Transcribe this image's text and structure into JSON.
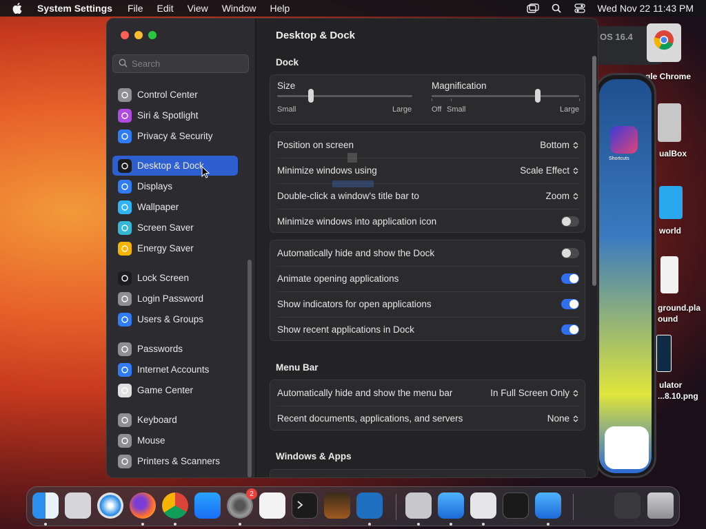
{
  "menubar": {
    "app_name": "System Settings",
    "items": [
      "File",
      "Edit",
      "View",
      "Window",
      "Help"
    ],
    "datetime": "Wed Nov 22  11:43 PM"
  },
  "desktop": {
    "behind_window_text": "OS 16.4",
    "chrome_label": "Google Chrome",
    "vbox_label": "ualBox",
    "folder_label": "world",
    "playground_label_1": "ground.pla",
    "playground_label_2": "ound",
    "png_label_1": "ulator",
    "png_label_2": "...8.10.png",
    "phone_app_label": "Shortcuts"
  },
  "sidebar": {
    "search_placeholder": "Search",
    "items": [
      {
        "label": "Control Center",
        "icon": "control-center-icon",
        "color": "#8e8e93"
      },
      {
        "label": "Siri & Spotlight",
        "icon": "siri-icon",
        "color": "#b04be0"
      },
      {
        "label": "Privacy & Security",
        "icon": "hand-icon",
        "color": "#2f7cf6"
      },
      {
        "label": "Desktop & Dock",
        "icon": "dock-icon",
        "color": "#1c1c1e"
      },
      {
        "label": "Displays",
        "icon": "sun-icon",
        "color": "#2f7cf6"
      },
      {
        "label": "Wallpaper",
        "icon": "flower-icon",
        "color": "#2fb4f6"
      },
      {
        "label": "Screen Saver",
        "icon": "screensaver-icon",
        "color": "#35b8d6"
      },
      {
        "label": "Energy Saver",
        "icon": "bulb-icon",
        "color": "#f5b400"
      },
      {
        "label": "Lock Screen",
        "icon": "lock-icon",
        "color": "#1c1c1e"
      },
      {
        "label": "Login Password",
        "icon": "lock-icon",
        "color": "#8e8e93"
      },
      {
        "label": "Users & Groups",
        "icon": "users-icon",
        "color": "#2f7cf6"
      },
      {
        "label": "Passwords",
        "icon": "key-icon",
        "color": "#8e8e93"
      },
      {
        "label": "Internet Accounts",
        "icon": "at-icon",
        "color": "#2f7cf6"
      },
      {
        "label": "Game Center",
        "icon": "game-center-icon",
        "color": "#e0e0e0"
      },
      {
        "label": "Keyboard",
        "icon": "keyboard-icon",
        "color": "#8e8e93"
      },
      {
        "label": "Mouse",
        "icon": "mouse-icon",
        "color": "#8e8e93"
      },
      {
        "label": "Printers & Scanners",
        "icon": "printer-icon",
        "color": "#8e8e93"
      }
    ],
    "active_index": 3
  },
  "content": {
    "title": "Desktop & Dock",
    "dock_section": "Dock",
    "size_label": "Size",
    "size_min": "Small",
    "size_max": "Large",
    "size_value": 0.25,
    "mag_label": "Magnification",
    "mag_off": "Off",
    "mag_min": "Small",
    "mag_max": "Large",
    "mag_value": 0.72,
    "rows_group1": [
      {
        "label": "Position on screen",
        "value": "Bottom"
      },
      {
        "label": "Minimize windows using",
        "value": "Scale Effect"
      },
      {
        "label": "Double-click a window's title bar to",
        "value": "Zoom"
      },
      {
        "label": "Minimize windows into application icon",
        "toggle": false
      }
    ],
    "rows_group2": [
      {
        "label": "Automatically hide and show the Dock",
        "toggle": false
      },
      {
        "label": "Animate opening applications",
        "toggle": true
      },
      {
        "label": "Show indicators for open applications",
        "toggle": true
      },
      {
        "label": "Show recent applications in Dock",
        "toggle": true
      }
    ],
    "menubar_section": "Menu Bar",
    "rows_group3": [
      {
        "label": "Automatically hide and show the menu bar",
        "value": "In Full Screen Only"
      },
      {
        "label": "Recent documents, applications, and servers",
        "value": "None"
      }
    ],
    "windows_section": "Windows & Apps"
  },
  "dock": {
    "settings_badge": "2"
  },
  "colors": {
    "accent": "#2e5fd0",
    "toggle_on": "#2f6ff0"
  }
}
